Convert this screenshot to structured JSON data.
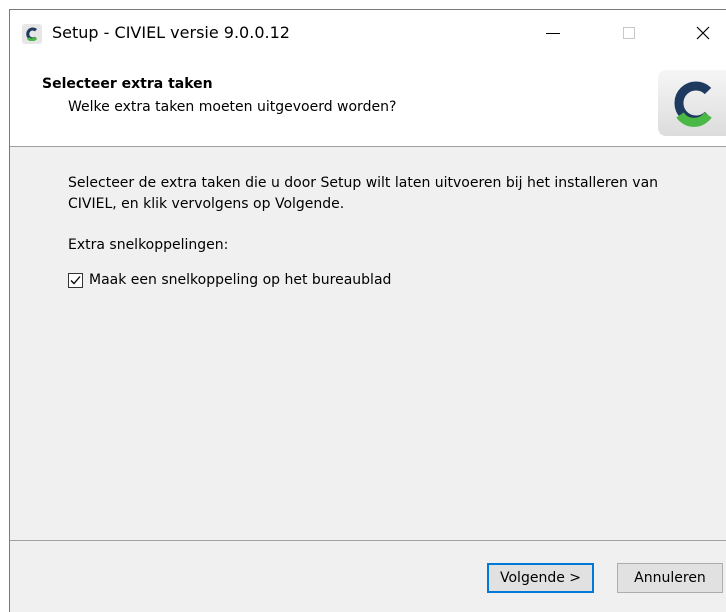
{
  "window": {
    "title": "Setup - CIVIEL versie 9.0.0.12",
    "icon": "civiel-app-icon"
  },
  "header": {
    "title": "Selecteer extra taken",
    "subtitle": "Welke extra taken moeten uitgevoerd worden?",
    "logo_icon": "civiel-logo-icon"
  },
  "body": {
    "description": "Selecteer de extra taken die u door Setup wilt laten uitvoeren bij het installeren van CIVIEL, en klik vervolgens op Volgende.",
    "section_label": "Extra snelkoppelingen:",
    "tasks": [
      {
        "label": "Maak een snelkoppeling op het bureaublad",
        "checked": true
      }
    ]
  },
  "footer": {
    "next_label": "Volgende >",
    "cancel_label": "Annuleren"
  },
  "colors": {
    "accent": "#0078d7",
    "logo_green": "#4ab844",
    "logo_dark": "#1f3a5f"
  }
}
